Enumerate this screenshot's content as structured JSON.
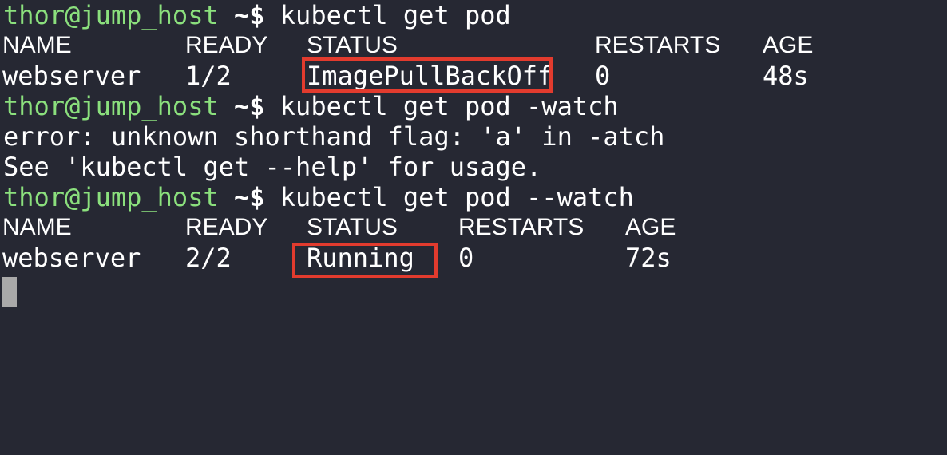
{
  "terminal": {
    "lines": [
      {
        "type": "prompt",
        "user_host": "thor@jump_host",
        "symbol": "~$",
        "command": "kubectl get pod"
      },
      {
        "type": "table-header",
        "cols": [
          "NAME",
          "READY",
          "STATUS",
          "RESTARTS",
          "AGE"
        ]
      },
      {
        "type": "table-row",
        "cols": [
          "webserver",
          "1/2",
          "ImagePullBackOff",
          "0",
          "48s"
        ]
      },
      {
        "type": "prompt",
        "user_host": "thor@jump_host",
        "symbol": "~$",
        "command": "kubectl get pod -watch"
      },
      {
        "type": "output",
        "text": "error: unknown shorthand flag: 'a' in -atch"
      },
      {
        "type": "output",
        "text": "See 'kubectl get --help' for usage."
      },
      {
        "type": "prompt",
        "user_host": "thor@jump_host",
        "symbol": "~$",
        "command": "kubectl get pod --watch"
      },
      {
        "type": "table-header",
        "cols": [
          "NAME",
          "READY",
          "STATUS",
          "RESTARTS",
          "AGE"
        ]
      },
      {
        "type": "table-row",
        "cols": [
          "webserver",
          "2/2",
          "Running",
          "0",
          "72s"
        ]
      }
    ]
  },
  "colors": {
    "background": "#262833",
    "prompt_user": "#8be07d",
    "text": "#ffffff",
    "highlight_box": "#e23b2e",
    "cursor": "#a9a9a9"
  }
}
